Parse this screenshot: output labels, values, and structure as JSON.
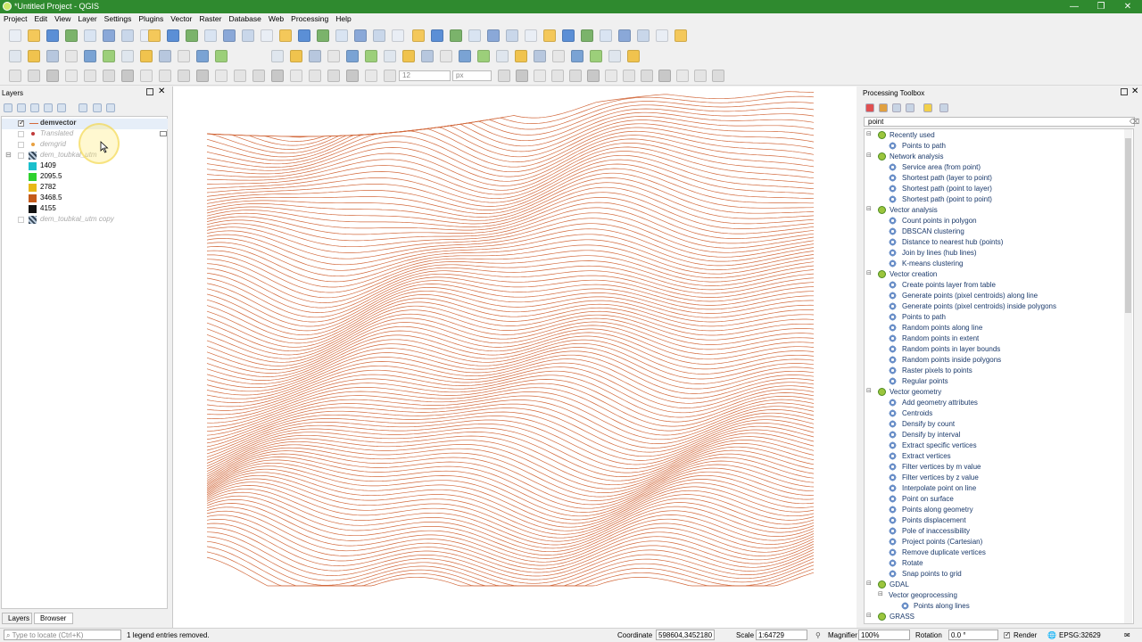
{
  "window": {
    "title": "*Untitled Project - QGIS",
    "controls": [
      "—",
      "❐",
      "✕"
    ]
  },
  "menu": [
    "Project",
    "Edit",
    "View",
    "Layer",
    "Settings",
    "Plugins",
    "Vector",
    "Raster",
    "Database",
    "Web",
    "Processing",
    "Help"
  ],
  "toolbar": {
    "font_size_value": "12",
    "font_unit": "px"
  },
  "layers_panel": {
    "title": "Layers",
    "items": [
      {
        "label": "demvector",
        "checked": true,
        "bold": true
      },
      {
        "label": "Translated",
        "checked": false,
        "dim": true
      },
      {
        "label": "demgrid",
        "checked": false,
        "dim": true
      },
      {
        "label": "dem_toubkal_utm",
        "checked": false,
        "dim": true
      }
    ],
    "legend": [
      {
        "label": "1409",
        "color": "#1bbfcc"
      },
      {
        "label": "2095.5",
        "color": "#2ed12e"
      },
      {
        "label": "2782",
        "color": "#e8b818"
      },
      {
        "label": "3468.5",
        "color": "#c45a1a"
      },
      {
        "label": "4155",
        "color": "#111111"
      }
    ],
    "copy_layer": "dem_toubkal_utm copy",
    "tabs": [
      "Layers",
      "Browser"
    ]
  },
  "processing": {
    "title": "Processing Toolbox",
    "search_value": "point",
    "rows": [
      {
        "type": "group",
        "label": "Recently used"
      },
      {
        "type": "item",
        "label": "Points to path"
      },
      {
        "type": "group",
        "label": "Network analysis"
      },
      {
        "type": "item",
        "label": "Service area (from point)"
      },
      {
        "type": "item",
        "label": "Shortest path (layer to point)"
      },
      {
        "type": "item",
        "label": "Shortest path (point to layer)"
      },
      {
        "type": "item",
        "label": "Shortest path (point to point)"
      },
      {
        "type": "group",
        "label": "Vector analysis"
      },
      {
        "type": "item",
        "label": "Count points in polygon"
      },
      {
        "type": "item",
        "label": "DBSCAN clustering"
      },
      {
        "type": "item",
        "label": "Distance to nearest hub (points)"
      },
      {
        "type": "item",
        "label": "Join by lines (hub lines)"
      },
      {
        "type": "item",
        "label": "K-means clustering"
      },
      {
        "type": "group",
        "label": "Vector creation"
      },
      {
        "type": "item",
        "label": "Create points layer from table"
      },
      {
        "type": "item",
        "label": "Generate points (pixel centroids) along line"
      },
      {
        "type": "item",
        "label": "Generate points (pixel centroids) inside polygons"
      },
      {
        "type": "item",
        "label": "Points to path"
      },
      {
        "type": "item",
        "label": "Random points along line"
      },
      {
        "type": "item",
        "label": "Random points in extent"
      },
      {
        "type": "item",
        "label": "Random points in layer bounds"
      },
      {
        "type": "item",
        "label": "Random points inside polygons"
      },
      {
        "type": "item",
        "label": "Raster pixels to points"
      },
      {
        "type": "item",
        "label": "Regular points"
      },
      {
        "type": "group",
        "label": "Vector geometry"
      },
      {
        "type": "item",
        "label": "Add geometry attributes"
      },
      {
        "type": "item",
        "label": "Centroids"
      },
      {
        "type": "item",
        "label": "Densify by count"
      },
      {
        "type": "item",
        "label": "Densify by interval"
      },
      {
        "type": "item",
        "label": "Extract specific vertices"
      },
      {
        "type": "item",
        "label": "Extract vertices"
      },
      {
        "type": "item",
        "label": "Filter vertices by m value"
      },
      {
        "type": "item",
        "label": "Filter vertices by z value"
      },
      {
        "type": "item",
        "label": "Interpolate point on line"
      },
      {
        "type": "item",
        "label": "Point on surface"
      },
      {
        "type": "item",
        "label": "Points along geometry"
      },
      {
        "type": "item",
        "label": "Points displacement"
      },
      {
        "type": "item",
        "label": "Pole of inaccessibility"
      },
      {
        "type": "item",
        "label": "Project points (Cartesian)"
      },
      {
        "type": "item",
        "label": "Remove duplicate vertices"
      },
      {
        "type": "item",
        "label": "Rotate"
      },
      {
        "type": "item",
        "label": "Snap points to grid"
      },
      {
        "type": "group",
        "label": "GDAL"
      },
      {
        "type": "subgroup",
        "label": "Vector geoprocessing"
      },
      {
        "type": "subitem",
        "label": "Points along lines"
      },
      {
        "type": "group",
        "label": "GRASS"
      }
    ]
  },
  "status": {
    "locate_placeholder": "Type to locate (Ctrl+K)",
    "message": "1 legend entries removed.",
    "coordinate_label": "Coordinate",
    "coordinate_value": "598604,3452180",
    "scale_label": "Scale",
    "scale_value": "1:64729",
    "magnifier_label": "Magnifier",
    "magnifier_value": "100%",
    "rotation_label": "Rotation",
    "rotation_value": "0.0 °",
    "render_label": "Render",
    "crs": "EPSG:32629"
  },
  "colors": {
    "contour": "#d2693c",
    "title_bar": "#2f8a2f"
  }
}
